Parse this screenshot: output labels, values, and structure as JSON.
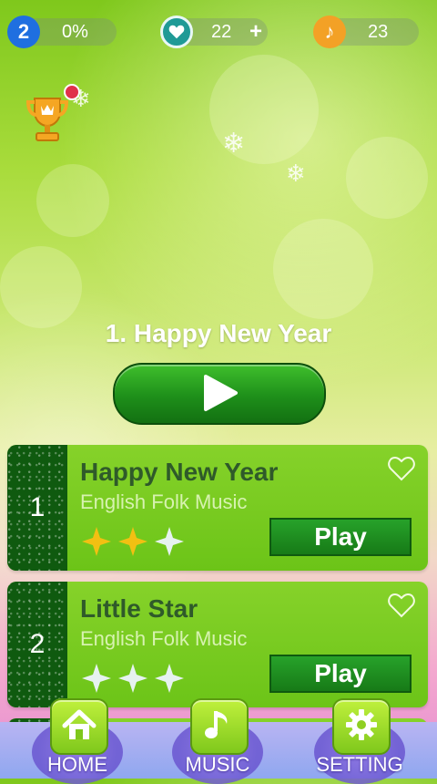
{
  "status_bar": {
    "level": "2",
    "progress": "0%",
    "lives": "22",
    "lives_plus": "+",
    "notes": "23"
  },
  "featured": {
    "title": "1. Happy New Year"
  },
  "songs": [
    {
      "number": "1",
      "title": "Happy New Year",
      "artist": "English Folk Music",
      "stars_earned": 2,
      "stars_total": 3,
      "play_label": "Play"
    },
    {
      "number": "2",
      "title": "Little Star",
      "artist": "English Folk Music",
      "stars_earned": 0,
      "stars_total": 3,
      "play_label": "Play"
    }
  ],
  "nav": {
    "home": "HOME",
    "music": "MUSIC",
    "setting": "SETTING"
  },
  "colors": {
    "accent_green": "#1e8f1a",
    "card_green": "#7ccc22",
    "star_gold": "#f2c012",
    "level_blue": "#1f6fe0",
    "notes_orange": "#f3a126"
  },
  "icons": [
    "heart-icon",
    "music-note-icon",
    "trophy-icon",
    "play-icon",
    "home-icon",
    "gear-icon",
    "star-icon"
  ]
}
